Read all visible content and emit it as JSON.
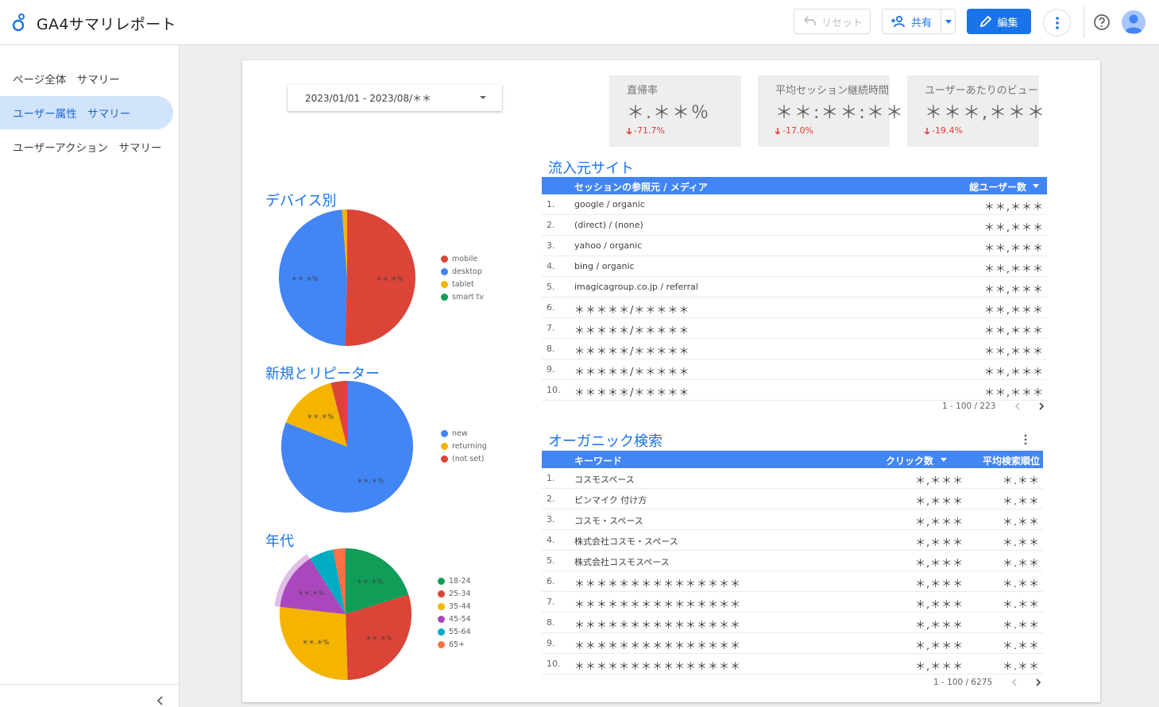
{
  "app": {
    "title": "GA4サマリレポート"
  },
  "toolbar": {
    "reset_label": "リセット",
    "share_label": "共有",
    "edit_label": "編集"
  },
  "colors": {
    "primary": "#1a73e8",
    "header_blue": "#4285f4",
    "red": "#db4437",
    "blue": "#4285f4",
    "yellow": "#f4b400",
    "green": "#0f9d58",
    "purple": "#ab47bc",
    "teal": "#00acc1",
    "orange": "#ff7043",
    "negative": "#e53935"
  },
  "sidebar": {
    "items": [
      {
        "label": "ページ全体　サマリー",
        "active": false
      },
      {
        "label": "ユーザー属性　サマリー",
        "active": true
      },
      {
        "label": "ユーザーアクション　サマリー",
        "active": false
      }
    ]
  },
  "date_range": {
    "value": "2023/01/01 - 2023/08/＊＊"
  },
  "kpis": [
    {
      "label": "直帰率",
      "value": "＊.＊＊％",
      "delta": "-71.7%"
    },
    {
      "label": "平均セッション継続時間",
      "value": "＊＊:＊＊:＊＊",
      "delta": "-17.0%"
    },
    {
      "label": "ユーザーあたりのビュー",
      "value": "＊＊＊,＊＊＊",
      "delta": "-19.4%"
    }
  ],
  "device_chart": {
    "title": "デバイス別",
    "legend": [
      "mobile",
      "desktop",
      "tablet",
      "smart tv"
    ],
    "slice_labels": [
      "＊＊.＊%",
      "＊＊.＊%"
    ]
  },
  "newrep_chart": {
    "title": "新規とリピーター",
    "legend": [
      "new",
      "returning",
      "(not set)"
    ],
    "slice_labels": [
      "＊＊.＊%",
      "＊＊.＊%"
    ]
  },
  "age_chart": {
    "title": "年代",
    "legend": [
      "18-24",
      "25-34",
      "35-44",
      "45-54",
      "55-64",
      "65+"
    ],
    "slice_labels": [
      "＊＊.＊%",
      "＊＊.＊%",
      "＊＊.＊%",
      "＊＊.＊%"
    ]
  },
  "chart_data": [
    {
      "type": "pie",
      "categories": [
        "mobile",
        "desktop",
        "tablet",
        "smart tv"
      ],
      "values": [
        50.5,
        48.3,
        1.2,
        0
      ]
    },
    {
      "type": "pie",
      "categories": [
        "new",
        "returning",
        "(not set)"
      ],
      "values": [
        81,
        15,
        4
      ]
    },
    {
      "type": "pie",
      "categories": [
        "18-24",
        "25-34",
        "35-44",
        "45-54",
        "55-64",
        "65+"
      ],
      "values": [
        20,
        29,
        27,
        14,
        6,
        3
      ]
    }
  ],
  "referral_table": {
    "title": "流入元サイト",
    "col_source": "セッションの参照元 / メディア",
    "col_users": "総ユーザー数",
    "rows": [
      {
        "idx": "1.",
        "source": "google / organic",
        "value": "＊＊,＊＊＊"
      },
      {
        "idx": "2.",
        "source": "(direct) / (none)",
        "value": "＊＊,＊＊＊"
      },
      {
        "idx": "3.",
        "source": "yahoo / organic",
        "value": "＊＊,＊＊＊"
      },
      {
        "idx": "4.",
        "source": "bing / organic",
        "value": "＊＊,＊＊＊"
      },
      {
        "idx": "5.",
        "source": "imagicagroup.co.jp / referral",
        "value": "＊＊,＊＊＊"
      },
      {
        "idx": "6.",
        "source": "＊＊＊＊＊/＊＊＊＊＊",
        "value": "＊＊,＊＊＊"
      },
      {
        "idx": "7.",
        "source": "＊＊＊＊＊/＊＊＊＊＊",
        "value": "＊＊,＊＊＊"
      },
      {
        "idx": "8.",
        "source": "＊＊＊＊＊/＊＊＊＊＊",
        "value": "＊＊,＊＊＊"
      },
      {
        "idx": "9.",
        "source": "＊＊＊＊＊/＊＊＊＊＊",
        "value": "＊＊,＊＊＊"
      },
      {
        "idx": "10.",
        "source": "＊＊＊＊＊/＊＊＊＊＊",
        "value": "＊＊,＊＊＊"
      }
    ],
    "pager": "1 - 100 / 223"
  },
  "organic_table": {
    "title": "オーガニック検索",
    "col_keyword": "キーワード",
    "col_clicks": "クリック数",
    "col_rank": "平均検索順位",
    "rows": [
      {
        "idx": "1.",
        "keyword": "コスモスペース",
        "clicks": "＊,＊＊＊",
        "rank": "＊.＊＊"
      },
      {
        "idx": "2.",
        "keyword": "ピンマイク 付け方",
        "clicks": "＊,＊＊＊",
        "rank": "＊.＊＊"
      },
      {
        "idx": "3.",
        "keyword": "コスモ・スペース",
        "clicks": "＊,＊＊＊",
        "rank": "＊.＊＊"
      },
      {
        "idx": "4.",
        "keyword": "株式会社コスモ・スペース",
        "clicks": "＊,＊＊＊",
        "rank": "＊.＊＊"
      },
      {
        "idx": "5.",
        "keyword": "株式会社コスモスペース",
        "clicks": "＊,＊＊＊",
        "rank": "＊.＊＊"
      },
      {
        "idx": "6.",
        "keyword": "＊＊＊＊＊＊＊＊＊＊＊＊＊＊＊",
        "clicks": "＊,＊＊＊",
        "rank": "＊.＊＊"
      },
      {
        "idx": "7.",
        "keyword": "＊＊＊＊＊＊＊＊＊＊＊＊＊＊＊",
        "clicks": "＊,＊＊＊",
        "rank": "＊.＊＊"
      },
      {
        "idx": "8.",
        "keyword": "＊＊＊＊＊＊＊＊＊＊＊＊＊＊＊",
        "clicks": "＊,＊＊＊",
        "rank": "＊.＊＊"
      },
      {
        "idx": "9.",
        "keyword": "＊＊＊＊＊＊＊＊＊＊＊＊＊＊＊",
        "clicks": "＊,＊＊＊",
        "rank": "＊.＊＊"
      },
      {
        "idx": "10.",
        "keyword": "＊＊＊＊＊＊＊＊＊＊＊＊＊＊＊",
        "clicks": "＊,＊＊＊",
        "rank": "＊.＊＊"
      }
    ],
    "pager": "1 - 100 / 6275"
  }
}
